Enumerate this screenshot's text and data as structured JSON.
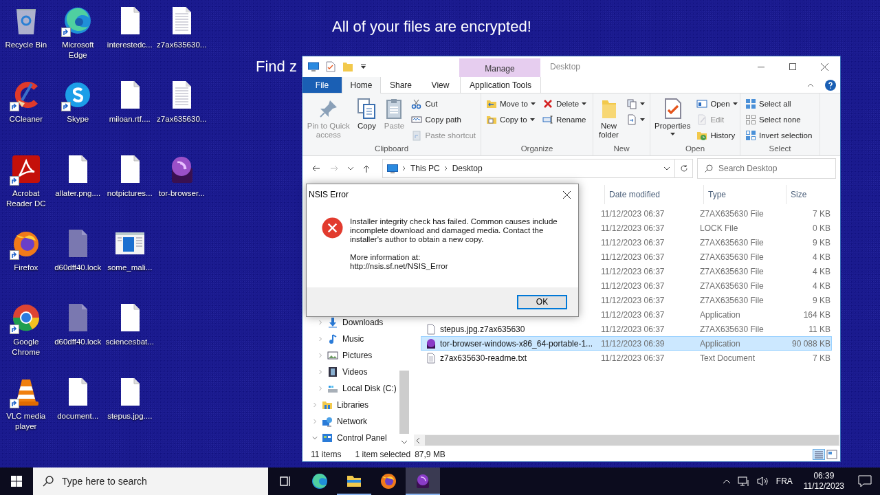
{
  "desktop": {
    "banner": "All of your files are encrypted!",
    "banner_2": "Find z"
  },
  "desktop_icons": [
    {
      "label": "Recycle Bin",
      "kind": "recycle",
      "shortcut": false
    },
    {
      "label": "CCleaner",
      "kind": "ccleaner",
      "shortcut": true
    },
    {
      "label": "Acrobat Reader DC",
      "kind": "acrobat",
      "shortcut": true
    },
    {
      "label": "Firefox",
      "kind": "firefox",
      "shortcut": true
    },
    {
      "label": "Google Chrome",
      "kind": "chrome",
      "shortcut": true
    },
    {
      "label": "VLC media player",
      "kind": "vlc",
      "shortcut": true
    },
    {
      "label": "Microsoft Edge",
      "kind": "edge",
      "shortcut": true
    },
    {
      "label": "Skype",
      "kind": "skype",
      "shortcut": true
    },
    {
      "label": "allater.png....",
      "kind": "doc",
      "shortcut": false
    },
    {
      "label": "d60dff40.lock",
      "kind": "lockdoc",
      "shortcut": false
    },
    {
      "label": "d60dff40.lock",
      "kind": "lockdoc",
      "shortcut": false
    },
    {
      "label": "document...",
      "kind": "doc",
      "shortcut": false
    },
    {
      "label": "interestedc...",
      "kind": "doc",
      "shortcut": false
    },
    {
      "label": "miloan.rtf....",
      "kind": "doc",
      "shortcut": false
    },
    {
      "label": "notpictures...",
      "kind": "doc",
      "shortcut": false
    },
    {
      "label": "some_mali...",
      "kind": "window",
      "shortcut": false
    },
    {
      "label": "sciencesbat...",
      "kind": "doc",
      "shortcut": false
    },
    {
      "label": "stepus.jpg....",
      "kind": "doc",
      "shortcut": false
    },
    {
      "label": "z7ax635630...",
      "kind": "textdoc",
      "shortcut": false
    },
    {
      "label": "z7ax635630...",
      "kind": "textdoc",
      "shortcut": false
    },
    {
      "label": "tor-browser...",
      "kind": "tor",
      "shortcut": false
    }
  ],
  "explorer": {
    "title": "Desktop",
    "context_header": "Manage",
    "tabs": [
      {
        "label": "File",
        "kind": "file",
        "selected": false
      },
      {
        "label": "Home",
        "kind": "tab",
        "selected": true
      },
      {
        "label": "Share",
        "kind": "tab",
        "selected": false
      },
      {
        "label": "View",
        "kind": "tab",
        "selected": false
      },
      {
        "label": "Application Tools",
        "kind": "context",
        "selected": false
      }
    ],
    "ribbon_groups": [
      {
        "label": "Clipboard",
        "items": [
          {
            "kind": "large",
            "label": "Pin to Quick access",
            "disabled": true
          },
          {
            "kind": "large",
            "label": "Copy",
            "disabled": false
          },
          {
            "kind": "large",
            "label": "Paste",
            "disabled": true
          },
          {
            "kind": "stack",
            "items": [
              {
                "label": "Cut",
                "disabled": false
              },
              {
                "label": "Copy path",
                "disabled": false
              },
              {
                "label": "Paste shortcut",
                "disabled": true
              }
            ]
          }
        ]
      },
      {
        "label": "Organize",
        "items": [
          {
            "kind": "stack",
            "items": [
              {
                "label": "Move to",
                "disabled": false,
                "dropdown": true
              },
              {
                "label": "Copy to",
                "disabled": false,
                "dropdown": true
              }
            ]
          },
          {
            "kind": "stack",
            "items": [
              {
                "label": "Delete",
                "disabled": false,
                "dropdown": true
              },
              {
                "label": "Rename",
                "disabled": false
              }
            ]
          }
        ]
      },
      {
        "label": "New",
        "items": [
          {
            "kind": "large",
            "label": "New folder",
            "disabled": false
          },
          {
            "kind": "stack",
            "items": [
              {
                "disabled": false,
                "dropdown": true
              },
              {
                "disabled": false,
                "dropdown": true
              }
            ]
          }
        ]
      },
      {
        "label": "Open",
        "items": [
          {
            "kind": "large",
            "label": "Properties",
            "disabled": false,
            "dropdown": true
          },
          {
            "kind": "stack",
            "items": [
              {
                "label": "Open",
                "disabled": false,
                "dropdown": true
              },
              {
                "label": "Edit",
                "disabled": true
              },
              {
                "label": "History",
                "disabled": false
              }
            ]
          }
        ]
      },
      {
        "label": "Select",
        "items": [
          {
            "kind": "stack",
            "items": [
              {
                "label": "Select all",
                "disabled": false
              },
              {
                "label": "Select none",
                "disabled": false
              },
              {
                "label": "Invert selection",
                "disabled": false
              }
            ]
          }
        ]
      }
    ],
    "address": {
      "crumbs": [
        "This PC",
        "Desktop"
      ],
      "search_placeholder": "Search Desktop"
    },
    "nav_pane": {
      "items": [
        {
          "children": [
            {
              "label": "Downloads",
              "kind": "downloads",
              "expanded": false
            },
            {
              "label": "Music",
              "kind": "music",
              "expanded": false
            },
            {
              "label": "Pictures",
              "kind": "pictures",
              "expanded": false
            },
            {
              "label": "Videos",
              "kind": "videos",
              "expanded": false
            },
            {
              "label": "Local Disk (C:)",
              "kind": "disk",
              "expanded": false
            }
          ]
        },
        {
          "label": "Libraries",
          "kind": "libraries",
          "expanded": false
        },
        {
          "label": "Network",
          "kind": "network",
          "expanded": false
        },
        {
          "label": "Control Panel",
          "kind": "controlpanel",
          "expanded": true
        }
      ]
    },
    "columns": [
      "Date modified",
      "Type",
      "Size"
    ],
    "rows": [
      {
        "date": "11/12/2023 06:37",
        "type": "Z7AX635630 File",
        "size": "7 KB",
        "selected": false
      },
      {
        "date": "11/12/2023 06:37",
        "type": "LOCK File",
        "size": "0 KB",
        "selected": false
      },
      {
        "date": "11/12/2023 06:37",
        "type": "Z7AX635630 File",
        "size": "9 KB",
        "selected": false
      },
      {
        "date": "11/12/2023 06:37",
        "type": "Z7AX635630 File",
        "size": "4 KB",
        "selected": false
      },
      {
        "date": "11/12/2023 06:37",
        "type": "Z7AX635630 File",
        "size": "4 KB",
        "selected": false
      },
      {
        "date": "11/12/2023 06:37",
        "type": "Z7AX635630 File",
        "size": "4 KB",
        "selected": false
      },
      {
        "date": "11/12/2023 06:37",
        "type": "Z7AX635630 File",
        "size": "9 KB",
        "selected": false
      },
      {
        "date": "11/12/2023 06:37",
        "type": "Application",
        "size": "164 KB",
        "selected": false
      },
      {
        "name": "stepus.jpg.z7ax635630",
        "kind": "file",
        "date": "11/12/2023 06:37",
        "type": "Z7AX635630 File",
        "size": "11 KB",
        "selected": false
      },
      {
        "name": "tor-browser-windows-x86_64-portable-1...",
        "kind": "app",
        "date": "11/12/2023 06:39",
        "type": "Application",
        "size": "90 088 KB",
        "selected": true
      },
      {
        "name": "z7ax635630-readme.txt",
        "kind": "text",
        "date": "11/12/2023 06:37",
        "type": "Text Document",
        "size": "7 KB",
        "selected": false
      }
    ],
    "status": {
      "count": "11 items",
      "selection": "1 item selected",
      "size": "87,9 MB"
    }
  },
  "dialog": {
    "title": "NSIS Error",
    "message": "Installer integrity check has failed. Common causes include incomplete download and damaged media. Contact the installer's author to obtain a new copy.",
    "more_info": "More information at:",
    "url": "http://nsis.sf.net/NSIS_Error",
    "button": {
      "label": "OK",
      "focused": true
    }
  },
  "taskbar": {
    "search_placeholder": "Type here to search",
    "apps": [
      {
        "kind": "taskview",
        "running": false,
        "active": false
      },
      {
        "kind": "edge",
        "running": false,
        "active": false
      },
      {
        "kind": "explorer",
        "running": true,
        "active": false
      },
      {
        "kind": "firefox",
        "running": false,
        "active": false
      },
      {
        "kind": "tor",
        "running": true,
        "active": true
      }
    ],
    "language": "FRA",
    "time": "06:39",
    "date": "11/12/2023"
  }
}
